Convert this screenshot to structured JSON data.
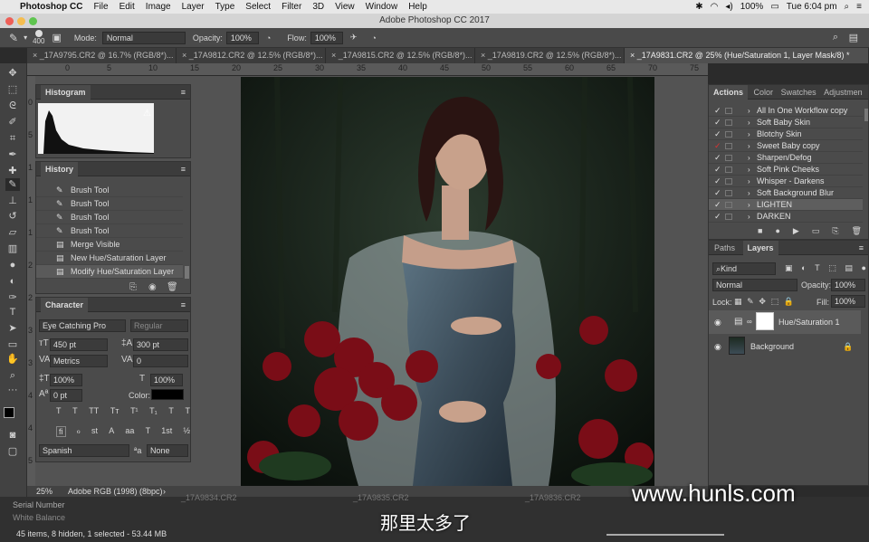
{
  "mac_menu": {
    "apple": "",
    "app_name": "Photoshop CC",
    "items": [
      "File",
      "Edit",
      "Image",
      "Layer",
      "Type",
      "Select",
      "Filter",
      "3D",
      "View",
      "Window",
      "Help"
    ],
    "battery": "100%",
    "clock": "Tue 6:04 pm"
  },
  "window_title": "Adobe Photoshop CC 2017",
  "options_bar": {
    "brush_size": "400",
    "mode_label": "Mode:",
    "mode_value": "Normal",
    "opacity_label": "Opacity:",
    "opacity_value": "100%",
    "flow_label": "Flow:",
    "flow_value": "100%"
  },
  "doc_tabs": [
    "_17A9795.CR2 @ 16.7% (RGB/8*)...",
    "_17A9812.CR2 @ 12.5% (RGB/8*)...",
    "_17A9815.CR2 @ 12.5% (RGB/8*)...",
    "_17A9819.CR2 @ 12.5% (RGB/8*)...",
    "_17A9831.CR2 @ 25% (Hue/Saturation 1, Layer Mask/8) *"
  ],
  "ruler_top": [
    "0",
    "5",
    "10",
    "15",
    "20",
    "25",
    "30",
    "35",
    "40",
    "45",
    "50",
    "55",
    "60",
    "65",
    "70",
    "75"
  ],
  "ruler_left": [
    "0",
    "5",
    "1",
    "1",
    "1",
    "2",
    "2",
    "3",
    "3",
    "4",
    "4",
    "5"
  ],
  "histogram": {
    "title": "Histogram",
    "warning": "⚠"
  },
  "history": {
    "title": "History",
    "items": [
      "Brush Tool",
      "Brush Tool",
      "Brush Tool",
      "Brush Tool",
      "Merge Visible",
      "New Hue/Saturation Layer",
      "Modify Hue/Saturation Layer"
    ]
  },
  "character": {
    "title": "Character",
    "font_family": "Eye Catching Pro",
    "font_style": "Regular",
    "font_size": "450 pt",
    "leading": "300 pt",
    "kerning": "Metrics",
    "tracking": "0",
    "vscale": "100%",
    "hscale": "100%",
    "baseline": "0 pt",
    "color_label": "Color:",
    "language": "Spanish",
    "aa_label": "ªa",
    "aa_value": "None",
    "style_buttons": [
      "T",
      "T",
      "TT",
      "Tт",
      "T¹",
      "T₁",
      "T",
      "T"
    ],
    "ot_buttons": [
      "fi",
      "ℴ",
      "st",
      "A",
      "aa",
      "T",
      "1st",
      "½"
    ]
  },
  "actions_panel": {
    "tabs": [
      "Actions",
      "Color",
      "Swatches",
      "Adjustmen"
    ],
    "items": [
      "All In One Workflow copy",
      "Soft Baby Skin",
      "Blotchy Skin",
      "Sweet Baby copy",
      "Sharpen/Defog",
      "Soft Pink Cheeks",
      "Whisper - Darkens",
      "Soft Background Blur",
      "LIGHTEN",
      "DARKEN"
    ]
  },
  "layers_panel": {
    "tabs": [
      "Paths",
      "Layers"
    ],
    "kind_label": "Kind",
    "blend_mode": "Normal",
    "opacity_label": "Opacity:",
    "opacity_value": "100%",
    "lock_label": "Lock:",
    "fill_label": "Fill:",
    "fill_value": "100%",
    "layers": [
      {
        "name": "Hue/Saturation 1"
      },
      {
        "name": "Background"
      }
    ]
  },
  "status": {
    "zoom": "25%",
    "profile": "Adobe RGB (1998) (8bpc)"
  },
  "finder_strip": {
    "items": [
      "Serial Number",
      "White Balance"
    ],
    "count_text": "45 items, 8 hidden, 1 selected - 53.44 MB",
    "thumbs": [
      "_17A9834.CR2",
      "_17A9835.CR2",
      "_17A9836.CR2"
    ]
  },
  "subtitle": "那里太多了",
  "watermark": "www.hunls.com",
  "colors": {
    "accent_blue": "#2f7bd6",
    "panel_bg": "#4b4b4b",
    "dark_bg": "#2b2b2b"
  }
}
